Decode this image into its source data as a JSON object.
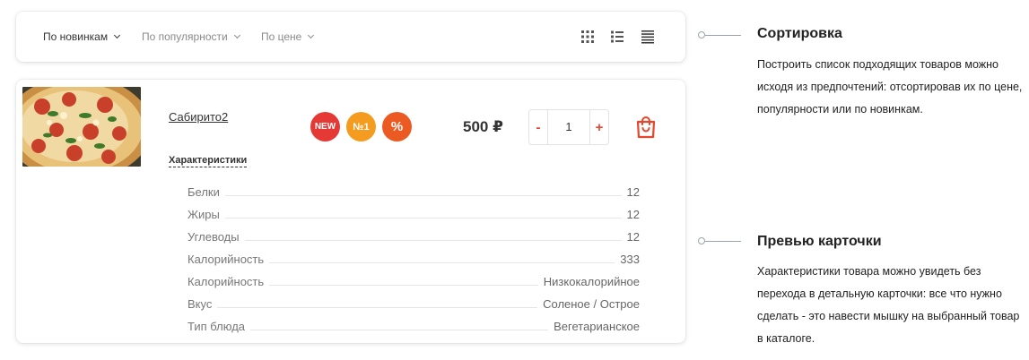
{
  "sort": {
    "options": [
      {
        "label": "По новинкам"
      },
      {
        "label": "По популярности"
      },
      {
        "label": "По цене"
      }
    ],
    "views": [
      "grid-view-icon",
      "list-view-icon",
      "table-view-icon"
    ]
  },
  "product": {
    "name": "Сабирито2",
    "badges": [
      {
        "label": "NEW",
        "color": "#e53935"
      },
      {
        "label": "№1",
        "color": "#f39c1f"
      },
      {
        "label": "%",
        "color": "#ec5a24"
      }
    ],
    "price": "500 ₽",
    "quantity": "1",
    "qty_minus": "-",
    "qty_plus": "+",
    "characteristics_title": "Характеристики",
    "specs": [
      {
        "label": "Белки",
        "value": "12"
      },
      {
        "label": "Жиры",
        "value": "12"
      },
      {
        "label": "Углеводы",
        "value": "12"
      },
      {
        "label": "Калорийность",
        "value": "333"
      },
      {
        "label": "Калорийность",
        "value": "Низкокалорийное"
      },
      {
        "label": "Вкус",
        "value": "Соленое / Острое"
      },
      {
        "label": "Тип блюда",
        "value": "Вегетарианское"
      }
    ]
  },
  "annotations": [
    {
      "title": "Сортировка",
      "text": "Построить список подходящих товаров можно исходя из предпочтений: отсортировав их по цене, популярности или по новинкам."
    },
    {
      "title": "Превью карточки",
      "text": "Характеристики товара можно увидеть без перехода в  детальную карточки: все что нужно сделать - это навести мышку на выбранный товар в каталоге."
    }
  ],
  "colors": {
    "accent": "#e8452c",
    "connector": "#9aa3ab"
  }
}
